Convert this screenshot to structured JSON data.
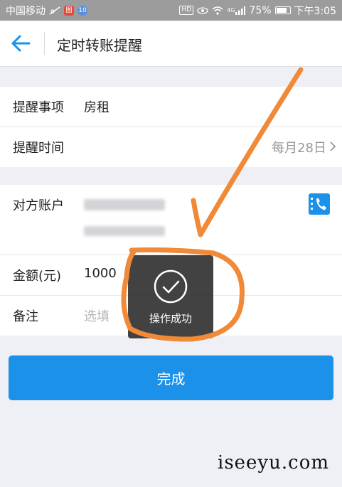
{
  "status_bar": {
    "carrier": "中国移动",
    "badge_red": "图",
    "badge_blue": "10",
    "hd": "HD",
    "signal_label": "4G",
    "battery": "75%",
    "time": "下午3:05"
  },
  "header": {
    "title": "定时转账提醒",
    "back_icon": "arrow-left-icon"
  },
  "form": {
    "item": {
      "label": "提醒事项",
      "value": "房租"
    },
    "time": {
      "label": "提醒时间",
      "value": "每月28日"
    },
    "account": {
      "label": "对方账户",
      "contact_icon": "phone-contact-icon"
    },
    "amount": {
      "label": "金额(元)",
      "value": "1000"
    },
    "note": {
      "label": "备注",
      "placeholder": "选填"
    }
  },
  "done_button": {
    "label": "完成"
  },
  "toast": {
    "text": "操作成功",
    "icon": "check-circle-icon"
  },
  "watermark": "iseeyu.com",
  "colors": {
    "accent": "#1b91ea",
    "annotation": "#f08a38",
    "toast_bg": "#282828"
  }
}
